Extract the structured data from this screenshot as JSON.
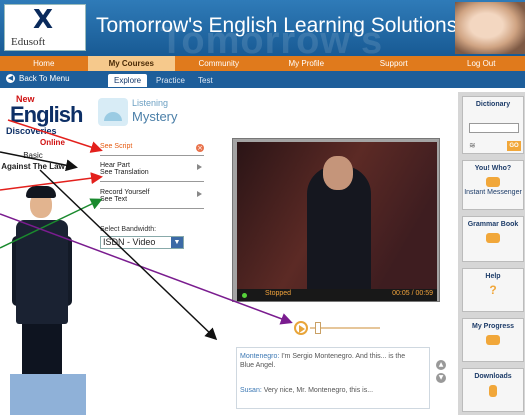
{
  "header": {
    "logo_name": "Edusoft",
    "tagline": "Tomorrow's English Learning Solutions... Today",
    "ghost": "Tomorrow's"
  },
  "nav": {
    "items": [
      "Home",
      "My Courses",
      "Community",
      "My Profile",
      "Support",
      "Log Out"
    ]
  },
  "subnav": {
    "back": "Back To Menu",
    "tabs": [
      "Explore",
      "Practice",
      "Test"
    ]
  },
  "course": {
    "new": "New",
    "title": "English",
    "subtitle": "Discoveries",
    "online": "Online"
  },
  "lesson": {
    "category": "Listening",
    "title": "Mystery"
  },
  "level": {
    "line1": "Basic",
    "line2": "Against The Law"
  },
  "options": [
    {
      "label": "See Script"
    },
    {
      "label": "Hear Part",
      "label2": "See Translation"
    },
    {
      "label": "Record Yourself",
      "label2": "See Text"
    }
  ],
  "bandwidth": {
    "label": "Select Bandwidth:",
    "value": "ISDN - Video"
  },
  "video": {
    "status": "Stopped",
    "time": "00:05 / 00:59",
    "progress": 0.08
  },
  "transcript": [
    {
      "speaker": "Montenegro:",
      "text": "I'm Sergio Montenegro. And this... is the",
      "cont": "Blue Angel."
    },
    {
      "speaker": "Susan:",
      "text": "Very nice, Mr. Montenegro, this is..."
    }
  ],
  "sidebar": {
    "dictionary": "Dictionary",
    "go": "GO",
    "who": "You! Who?",
    "who_sub": "Instant Messenger",
    "grammar": "Grammar Book",
    "help": "Help",
    "progress": "My Progress",
    "downloads": "Downloads"
  },
  "colors": {
    "brand": "#185a94",
    "nav": "#e07a1c",
    "accent": "#f1a73a"
  }
}
